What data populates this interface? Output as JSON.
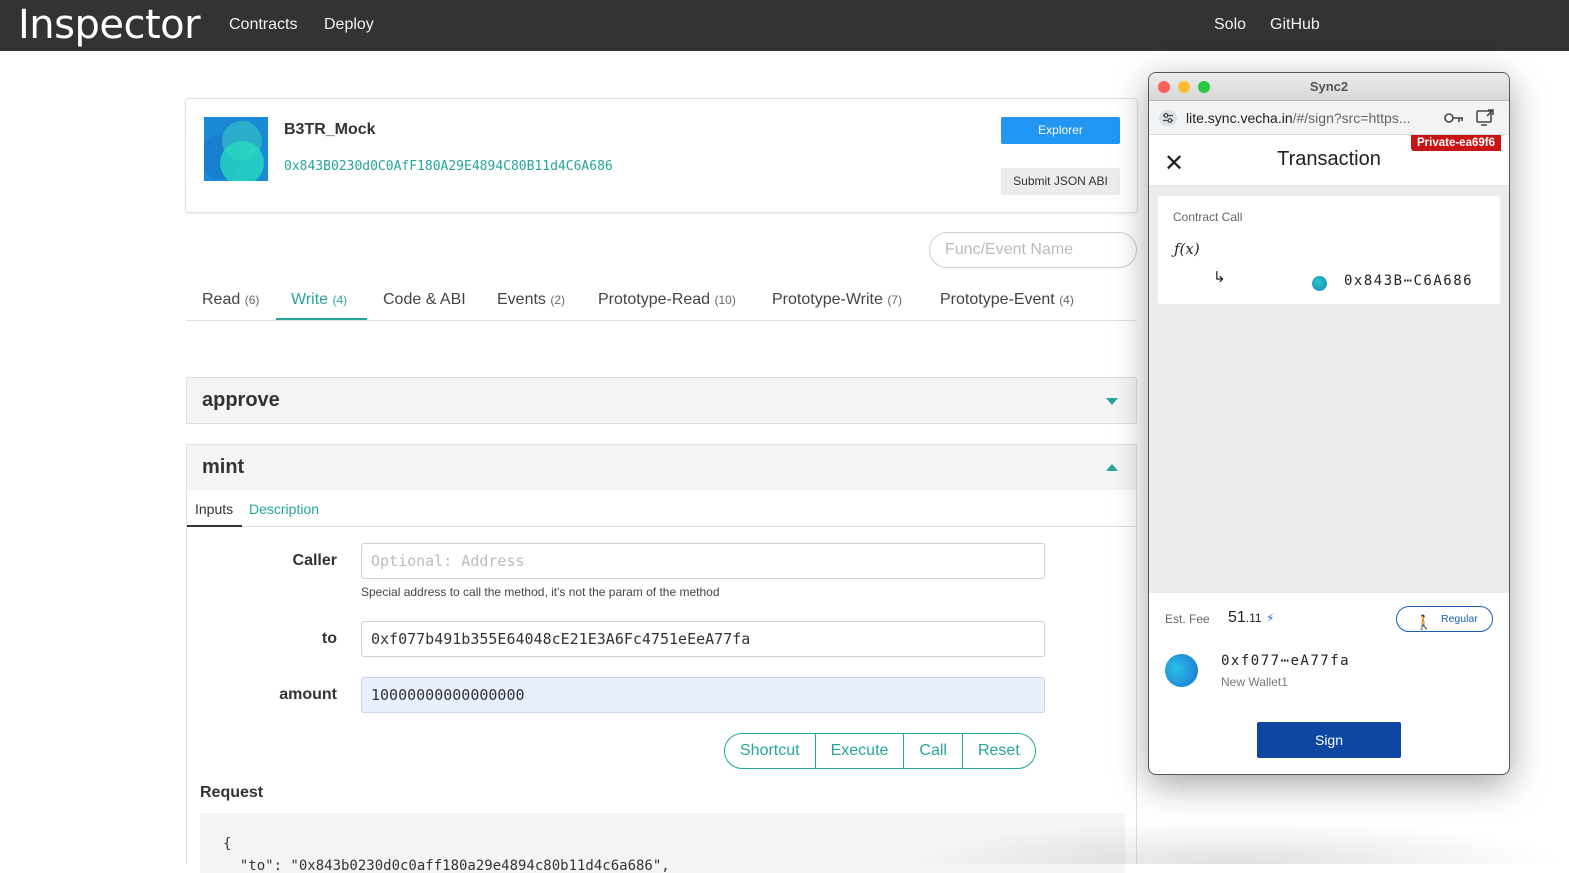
{
  "nav": {
    "brand": "Inspector",
    "links": [
      "Contracts",
      "Deploy"
    ],
    "right_links": [
      "Solo",
      "GitHub"
    ]
  },
  "contract": {
    "name": "B3TR_Mock",
    "address": "0x843B0230d0C0AfF180A29E4894C80B11d4C6A686",
    "explorer_label": "Explorer",
    "submit_abi_label": "Submit JSON ABI"
  },
  "search": {
    "placeholder": "Func/Event Name"
  },
  "tabs": [
    {
      "label": "Read",
      "count": "(6)"
    },
    {
      "label": "Write",
      "count": "(4)"
    },
    {
      "label": "Code & ABI",
      "count": ""
    },
    {
      "label": "Events",
      "count": "(2)"
    },
    {
      "label": "Prototype-Read",
      "count": "(10)"
    },
    {
      "label": "Prototype-Write",
      "count": "(7)"
    },
    {
      "label": "Prototype-Event",
      "count": "(4)"
    }
  ],
  "sections": {
    "approve": {
      "title": "approve"
    },
    "mint": {
      "title": "mint"
    }
  },
  "mint": {
    "subtabs": [
      "Inputs",
      "Description"
    ],
    "caller_label": "Caller",
    "caller_placeholder": "Optional: Address",
    "caller_hint": "Special address to call the method, it's not the param of the method",
    "to_label": "to",
    "to_value": "0xf077b491b355E64048cE21E3A6Fc4751eEeA77fa",
    "amount_label": "amount",
    "amount_value": "10000000000000000",
    "buttons": [
      "Shortcut",
      "Execute",
      "Call",
      "Reset"
    ],
    "request_label": "Request",
    "request_text": "{\n  \"to\": \"0x843b0230d0c0aff180a29e4894c80b11d4c6a686\","
  },
  "sync2": {
    "window_title": "Sync2",
    "url_host": "lite.sync.vecha.in",
    "url_rest": "/#/sign?src=https...",
    "network_badge": "Private-ea69f6",
    "title": "Transaction",
    "clause_label": "Contract Call",
    "fx_label": "ƒ(x)",
    "arrow": "↳",
    "to_short": "0x843B⋯C6A686",
    "fee_label": "Est. Fee",
    "fee_int": "51",
    "fee_dec": ".11",
    "speed_label": "Regular",
    "signer_short": "0xf077⋯eA77fa",
    "signer_name": "New Wallet1",
    "sign_label": "Sign"
  },
  "colors": {
    "accent": "#26a69a",
    "nav_bg": "#333333",
    "explorer_blue": "#2196f3",
    "sign_blue": "#0d47a1",
    "badge_red": "#c81414"
  }
}
